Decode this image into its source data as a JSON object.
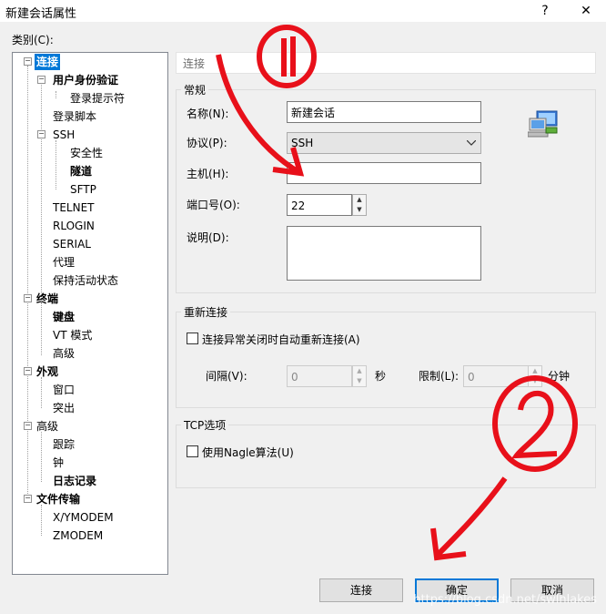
{
  "window": {
    "title": "新建会话属性",
    "help": "?",
    "close": "✕"
  },
  "category_label": "类别(C):",
  "tree": {
    "items": [
      {
        "label": "连接"
      },
      {
        "label": "用户身份验证"
      },
      {
        "label": "登录提示符"
      },
      {
        "label": "登录脚本"
      },
      {
        "label": "SSH"
      },
      {
        "label": "安全性"
      },
      {
        "label": "隧道"
      },
      {
        "label": "SFTP"
      },
      {
        "label": "TELNET"
      },
      {
        "label": "RLOGIN"
      },
      {
        "label": "SERIAL"
      },
      {
        "label": "代理"
      },
      {
        "label": "保持活动状态"
      },
      {
        "label": "终端"
      },
      {
        "label": "键盘"
      },
      {
        "label": "VT 模式"
      },
      {
        "label": "高级"
      },
      {
        "label": "外观"
      },
      {
        "label": "窗口"
      },
      {
        "label": "突出"
      },
      {
        "label": "高级"
      },
      {
        "label": "跟踪"
      },
      {
        "label": "钟"
      },
      {
        "label": "日志记录"
      },
      {
        "label": "文件传输"
      },
      {
        "label": "X/YMODEM"
      },
      {
        "label": "ZMODEM"
      }
    ],
    "expander_minus": "−"
  },
  "header": "连接",
  "general": {
    "title": "常规",
    "name_label": "名称(N):",
    "name_value": "新建会话",
    "protocol_label": "协议(P):",
    "protocol_value": "SSH",
    "host_label": "主机(H):",
    "host_value": "",
    "port_label": "端口号(O):",
    "port_value": "22",
    "desc_label": "说明(D):",
    "desc_value": ""
  },
  "reconnect": {
    "title": "重新连接",
    "checkbox_label": "连接异常关闭时自动重新连接(A)",
    "interval_label": "间隔(V):",
    "interval_value": "0",
    "interval_unit": "秒",
    "limit_label": "限制(L):",
    "limit_value": "0",
    "limit_unit": "分钟"
  },
  "tcp": {
    "title": "TCP选项",
    "checkbox_label": "使用Nagle算法(U)"
  },
  "buttons": {
    "connect": "连接",
    "ok": "确定",
    "cancel": "取消"
  },
  "watermark": "https://blog.csdn.net/swlhlakes",
  "annotation_color": "#e8101a"
}
